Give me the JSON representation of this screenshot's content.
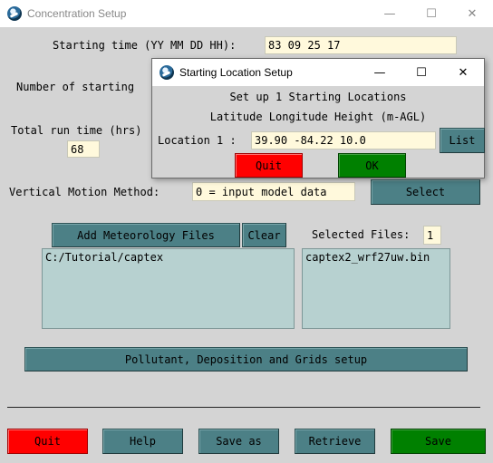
{
  "window": {
    "title": "Concentration Setup",
    "minimize": "—",
    "maximize": "☐",
    "close": "✕"
  },
  "form": {
    "start_time_label": "Starting time (YY MM DD HH):",
    "start_time_value": "83 09 25 17",
    "num_locations_label": "Number of starting",
    "run_time_label": "Total run time (hrs)",
    "run_time_value": "68",
    "vertical_label": "Vertical Motion Method:",
    "vertical_value": "0 = input model data",
    "vertical_select": "Select"
  },
  "meteorology": {
    "add_label": "Add Meteorology Files",
    "clear_label": "Clear",
    "selected_label": "Selected Files:",
    "selected_count": "1",
    "directories": [
      "C:/Tutorial/captex"
    ],
    "files": [
      "captex2_wrf27uw.bin"
    ]
  },
  "pollutant_button": "Pollutant, Deposition and Grids setup",
  "bottom_buttons": {
    "quit": "Quit",
    "help": "Help",
    "save_as": "Save as",
    "retrieve": "Retrieve",
    "save": "Save"
  },
  "dialog": {
    "title": "Starting Location Setup",
    "minimize": "—",
    "maximize": "☐",
    "close": "✕",
    "heading": "Set up 1 Starting Locations",
    "columns": "Latitude Longitude Height (m-AGL)",
    "location_label": "Location 1 :",
    "location_value": "39.90 -84.22 10.0",
    "list_label": "List",
    "quit_label": "Quit",
    "ok_label": "OK"
  },
  "colors": {
    "teal_button": "#4c8086",
    "quit_red": "#ff0000",
    "save_green": "#008000",
    "entry_bg": "#fff9dc",
    "list_bg": "#b7d1d0"
  }
}
